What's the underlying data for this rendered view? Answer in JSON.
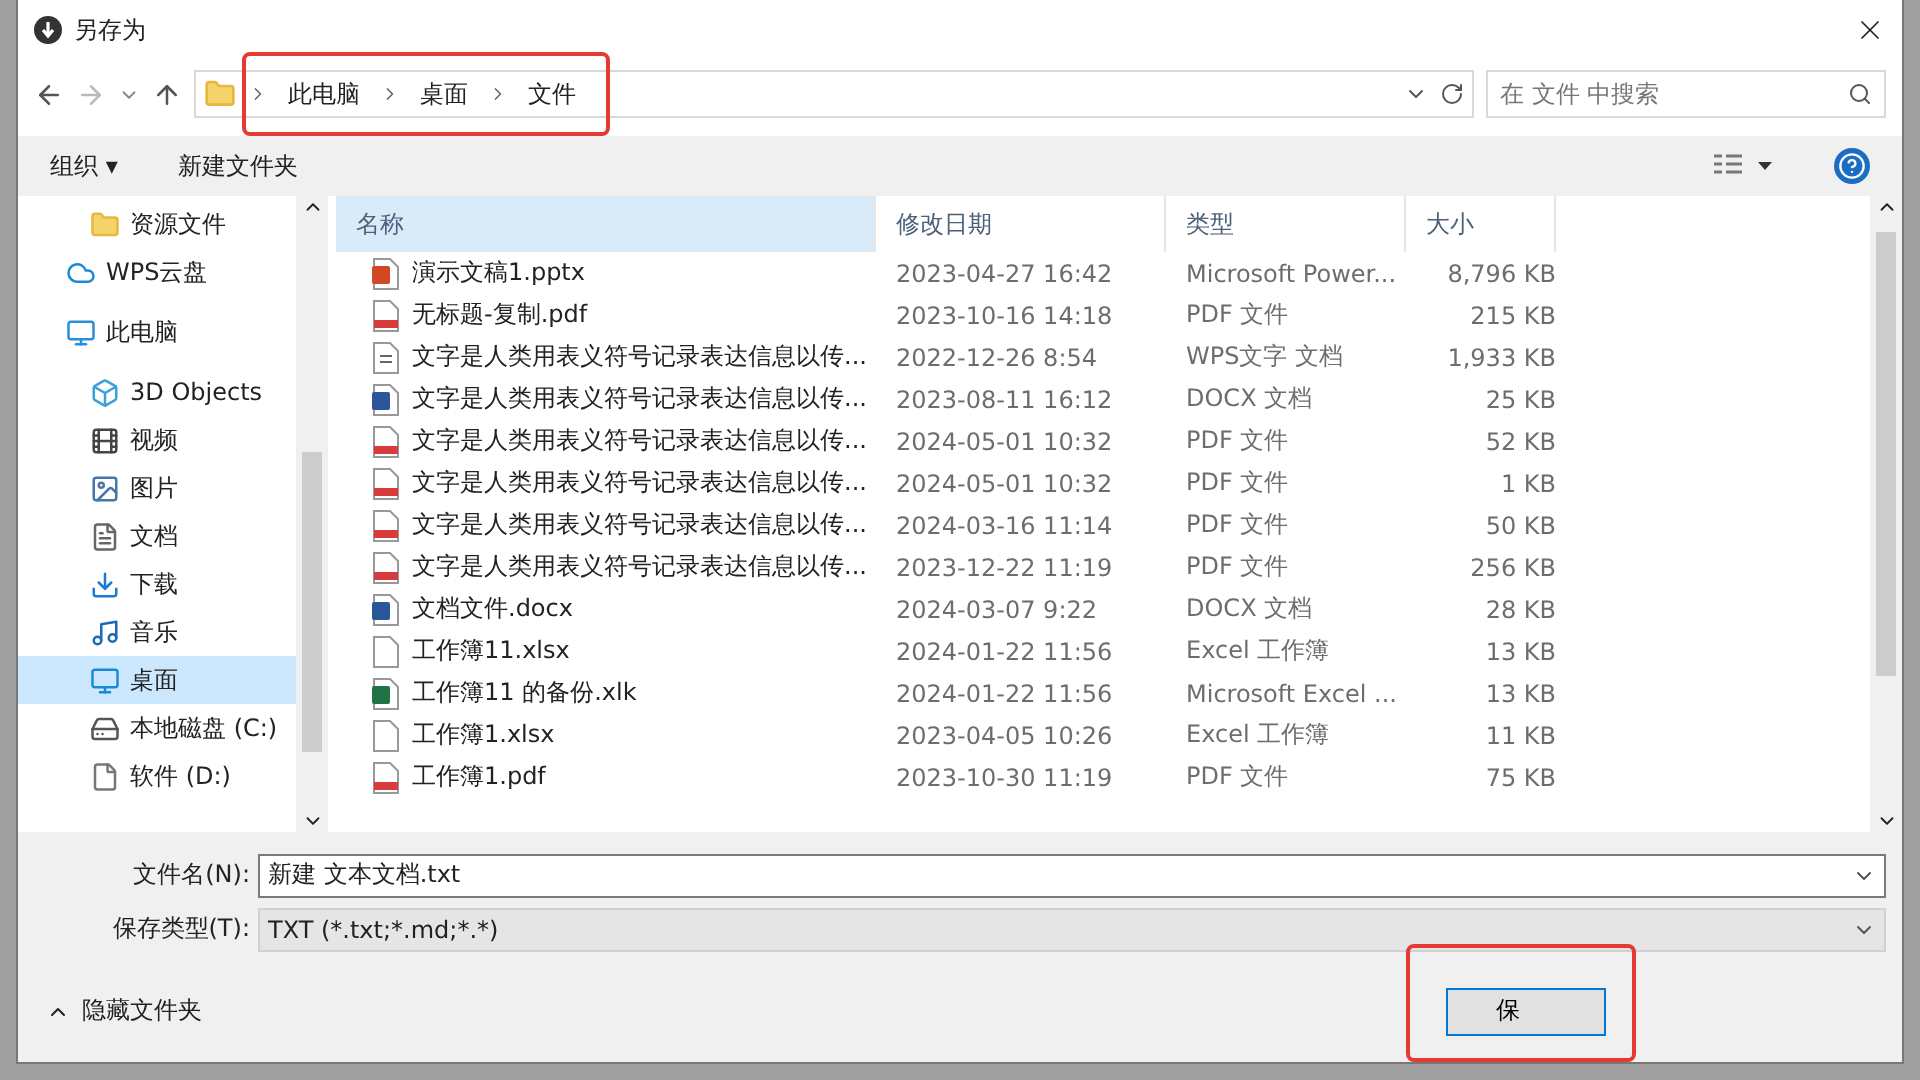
{
  "window": {
    "title": "另存为"
  },
  "address": {
    "highlighted": true,
    "crumbs": [
      "此电脑",
      "桌面",
      "文件"
    ]
  },
  "search": {
    "placeholder": "在 文件 中搜索"
  },
  "toolbar": {
    "organize": "组织 ▾",
    "new_folder": "新建文件夹"
  },
  "sidebar": {
    "items": [
      {
        "children": [
          {
            "label": "资源文件",
            "selected": false
          }
        ]
      },
      {
        "label": "WPS云盘",
        "selected": false
      },
      {
        "label": "此电脑",
        "selected": false,
        "children": [
          {
            "label": "3D Objects",
            "selected": false
          },
          {
            "label": "视频",
            "selected": false
          },
          {
            "label": "图片",
            "selected": false
          },
          {
            "label": "文档",
            "selected": false
          },
          {
            "label": "下载",
            "selected": false
          },
          {
            "label": "音乐",
            "selected": false
          },
          {
            "label": "桌面",
            "selected": true
          },
          {
            "label": "本地磁盘 (C:)",
            "selected": false
          },
          {
            "label": "软件 (D:)",
            "selected": false
          }
        ]
      }
    ]
  },
  "table": {
    "columns": [
      "名称",
      "修改日期",
      "类型",
      "大小"
    ],
    "rows": [
      {
        "kind": "pptx",
        "name": "演示文稿1.pptx",
        "date": "2023-04-27 16:42",
        "type": "Microsoft Power...",
        "size": "8,796 KB"
      },
      {
        "kind": "pdf",
        "name": "无标题-复制.pdf",
        "date": "2023-10-16 14:18",
        "type": "PDF 文件",
        "size": "215 KB"
      },
      {
        "kind": "wps",
        "name": "文字是人类用表义符号记录表达信息以传...",
        "date": "2022-12-26 8:54",
        "type": "WPS文字 文档",
        "size": "1,933 KB"
      },
      {
        "kind": "docx",
        "name": "文字是人类用表义符号记录表达信息以传...",
        "date": "2023-08-11 16:12",
        "type": "DOCX 文档",
        "size": "25 KB"
      },
      {
        "kind": "pdf",
        "name": "文字是人类用表义符号记录表达信息以传...",
        "date": "2024-05-01 10:32",
        "type": "PDF 文件",
        "size": "52 KB"
      },
      {
        "kind": "pdf",
        "name": "文字是人类用表义符号记录表达信息以传...",
        "date": "2024-05-01 10:32",
        "type": "PDF 文件",
        "size": "1 KB"
      },
      {
        "kind": "pdf",
        "name": "文字是人类用表义符号记录表达信息以传...",
        "date": "2024-03-16 11:14",
        "type": "PDF 文件",
        "size": "50 KB"
      },
      {
        "kind": "pdf",
        "name": "文字是人类用表义符号记录表达信息以传...",
        "date": "2023-12-22 11:19",
        "type": "PDF 文件",
        "size": "256 KB"
      },
      {
        "kind": "docx",
        "name": "文档文件.docx",
        "date": "2024-03-07 9:22",
        "type": "DOCX 文档",
        "size": "28 KB"
      },
      {
        "kind": "xlsx",
        "name": "工作簿11.xlsx",
        "date": "2024-01-22 11:56",
        "type": "Excel 工作簿",
        "size": "13 KB"
      },
      {
        "kind": "xlk",
        "name": "工作簿11 的备份.xlk",
        "date": "2024-01-22 11:56",
        "type": "Microsoft Excel ...",
        "size": "13 KB"
      },
      {
        "kind": "xlsx",
        "name": "工作簿1.xlsx",
        "date": "2023-04-05 10:26",
        "type": "Excel 工作簿",
        "size": "11 KB"
      },
      {
        "kind": "pdf",
        "name": "工作簿1.pdf",
        "date": "2023-10-30 11:19",
        "type": "PDF 文件",
        "size": "75 KB"
      }
    ]
  },
  "filename": {
    "label": "文件名(N):",
    "value": "新建 文本文档.txt"
  },
  "filetype": {
    "label": "保存类型(T):",
    "value": "TXT (*.txt;*.md;*.*)"
  },
  "hide_folders": "隐藏文件夹",
  "save_button": {
    "label": "保",
    "highlighted": true
  }
}
